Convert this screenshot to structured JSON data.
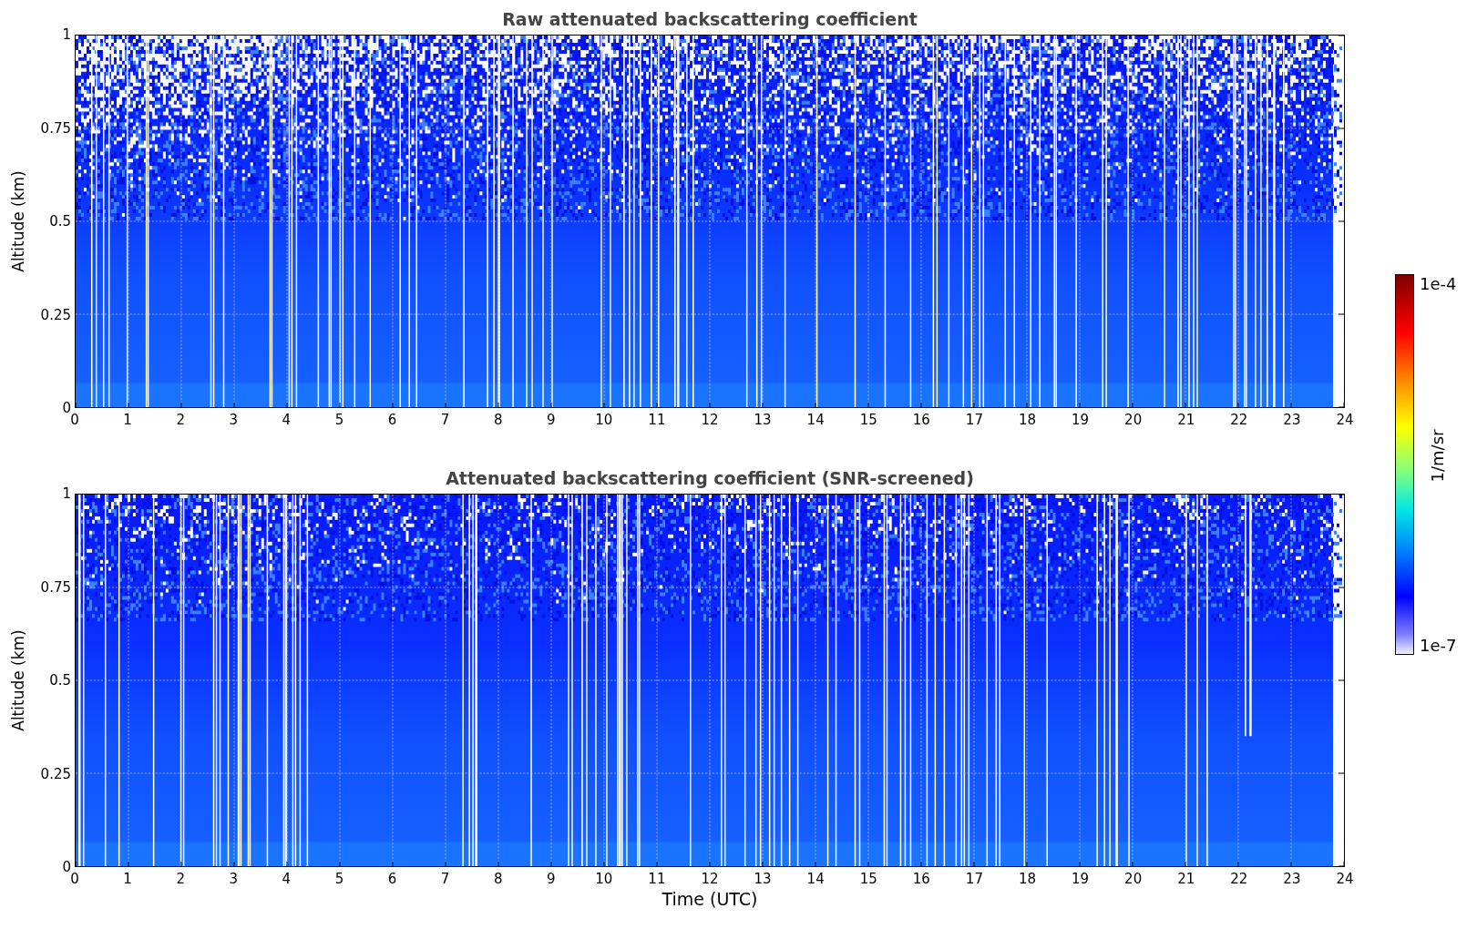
{
  "figure": {
    "panels": [
      {
        "kind": "raw",
        "title": "Raw attenuated backscattering coefficient",
        "ylabel": "Altitude (km)",
        "yticks": [
          "1",
          "0.75",
          "0.5",
          "0.25",
          "0"
        ],
        "xticks": [
          "0",
          "1",
          "2",
          "3",
          "4",
          "5",
          "6",
          "7",
          "8",
          "9",
          "10",
          "11",
          "12",
          "13",
          "14",
          "15",
          "16",
          "17",
          "18",
          "19",
          "20",
          "21",
          "22",
          "23",
          "24"
        ]
      },
      {
        "kind": "screened",
        "title": "Attenuated backscattering coefficient (SNR-screened)",
        "ylabel": "Altitude (km)",
        "yticks": [
          "1",
          "0.75",
          "0.5",
          "0.25",
          "0"
        ],
        "xticks": [
          "0",
          "1",
          "2",
          "3",
          "4",
          "5",
          "6",
          "7",
          "8",
          "9",
          "10",
          "11",
          "12",
          "13",
          "14",
          "15",
          "16",
          "17",
          "18",
          "19",
          "20",
          "21",
          "22",
          "23",
          "24"
        ]
      }
    ],
    "xlabel": "Time (UTC)",
    "colorbar": {
      "label": "1/m/sr",
      "max_label": "1e-4",
      "min_label": "1e-7"
    }
  }
}
